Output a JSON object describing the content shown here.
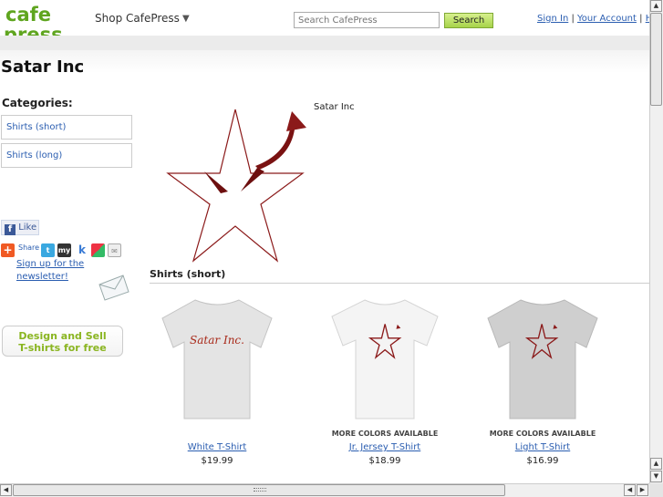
{
  "header": {
    "logo_top": "cafe",
    "logo_bottom": "press",
    "shop_label": "Shop CafePress",
    "shop_arrow": "▼",
    "search_placeholder": "Search CafePress",
    "search_button": "Search",
    "sign_in": "Sign In",
    "separator": "|",
    "your_account": "Your Account",
    "help_partial": "He"
  },
  "store": {
    "title": "Satar Inc",
    "logo_caption": "Satar Inc"
  },
  "sidebar": {
    "categories_title": "Categories:",
    "categories": [
      "Shirts (short)",
      "Shirts (long)"
    ],
    "like_label": "Like",
    "share_label": "Share",
    "newsletter": "Sign up for the newsletter!",
    "design_line1": "Design and Sell",
    "design_line2": "T-shirts for free"
  },
  "section": {
    "title": "Shirts (short)"
  },
  "products": [
    {
      "name": "White T-Shirt",
      "price": "$19.99",
      "more": "",
      "shirt_color": "#e4e4e4",
      "print": "Satar Inc."
    },
    {
      "name": "Jr. Jersey T-Shirt",
      "price": "$18.99",
      "more": "MORE COLORS AVAILABLE",
      "shirt_color": "#f4f4f4",
      "print": ""
    },
    {
      "name": "Light T-Shirt",
      "price": "$16.99",
      "more": "MORE COLORS AVAILABLE",
      "shirt_color": "#cfcfcf",
      "print": ""
    }
  ],
  "colors": {
    "brand_green": "#5fa51f",
    "link_blue": "#2a5db0",
    "star_red": "#8b1a1a"
  }
}
